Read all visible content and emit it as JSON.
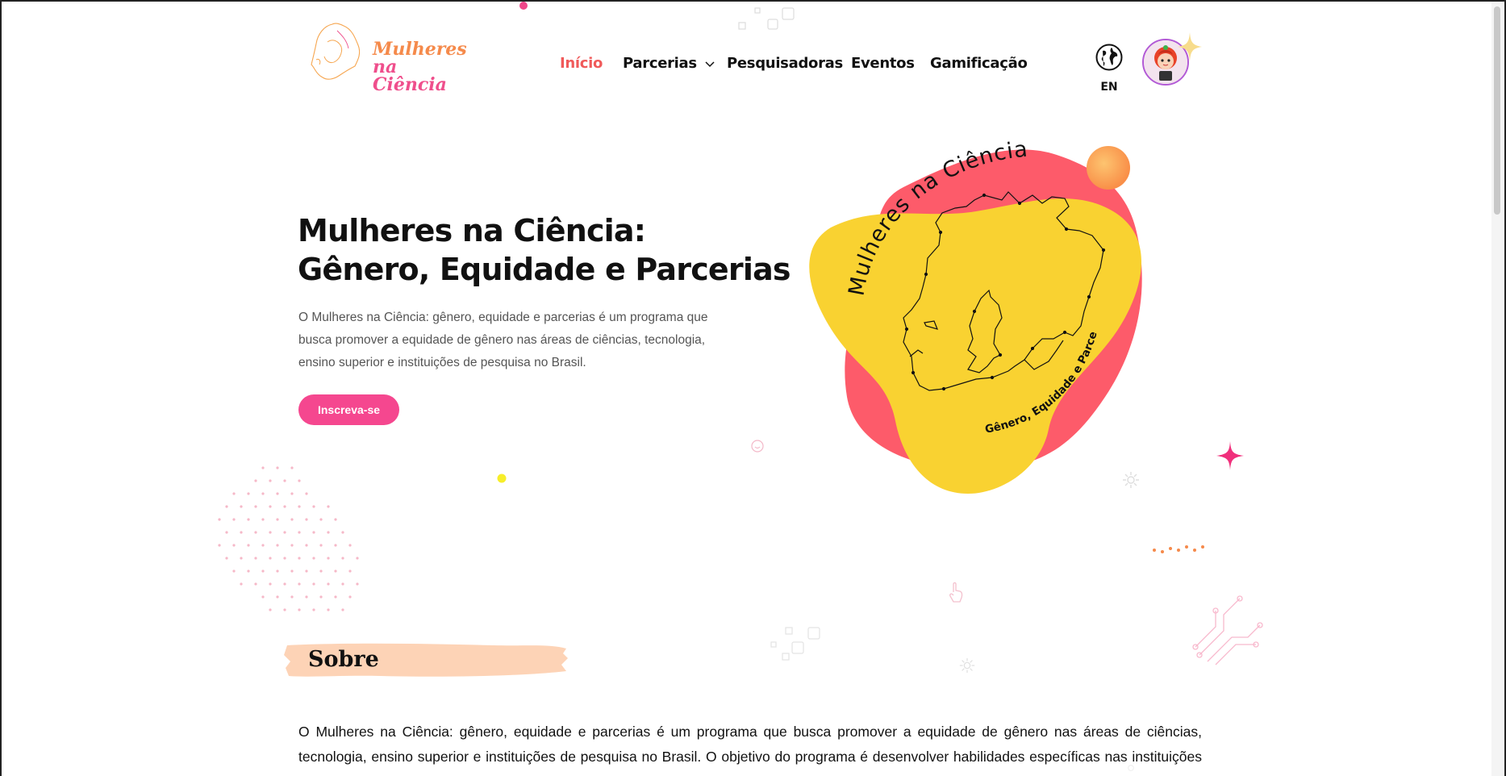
{
  "brand": {
    "logo_line1": "Mulheres",
    "logo_line2": "na Ciência"
  },
  "nav": {
    "items": [
      {
        "label": "Início",
        "active": true
      },
      {
        "label": "Parcerias",
        "has_dropdown": true
      },
      {
        "label": "Pesquisadoras"
      },
      {
        "label": "Eventos"
      },
      {
        "label": "Gamificação"
      }
    ]
  },
  "language": {
    "label": "EN",
    "icon": "globe-icon"
  },
  "hero": {
    "title_line1": "Mulheres na Ciência:",
    "title_line2": "Gênero, Equidade e Parcerias",
    "description": "O Mulheres na Ciência: gênero, equidade e parcerias é um programa que busca promover a equidade de gênero nas áreas de ciências, tecnologia, ensino superior e instituições de pesquisa no Brasil.",
    "cta_label": "Inscreva-se",
    "art_arc_top": "Mulheres na Ciência",
    "art_arc_bottom": "Gênero, Equidade e Parcerias"
  },
  "about": {
    "title": "Sobre",
    "text": "O Mulheres na Ciência: gênero, equidade e parcerias é um programa que busca promover a equidade de gênero nas áreas de ciências, tecnologia, ensino superior e instituições de pesquisa no Brasil. O objetivo do programa é desenvolver habilidades específicas nas instituições brasileiras e influenciar o desenvolvimento de políticas e práticas institucionais para a equidade de gênero."
  },
  "colors": {
    "accent_pink": "#f5478f",
    "active_nav": "#f05a5a",
    "blob_red": "#fd5b6a",
    "blob_yellow": "#f9d231",
    "orange_ball": "#f9a04b",
    "brush_peach": "#fdd3b6"
  }
}
